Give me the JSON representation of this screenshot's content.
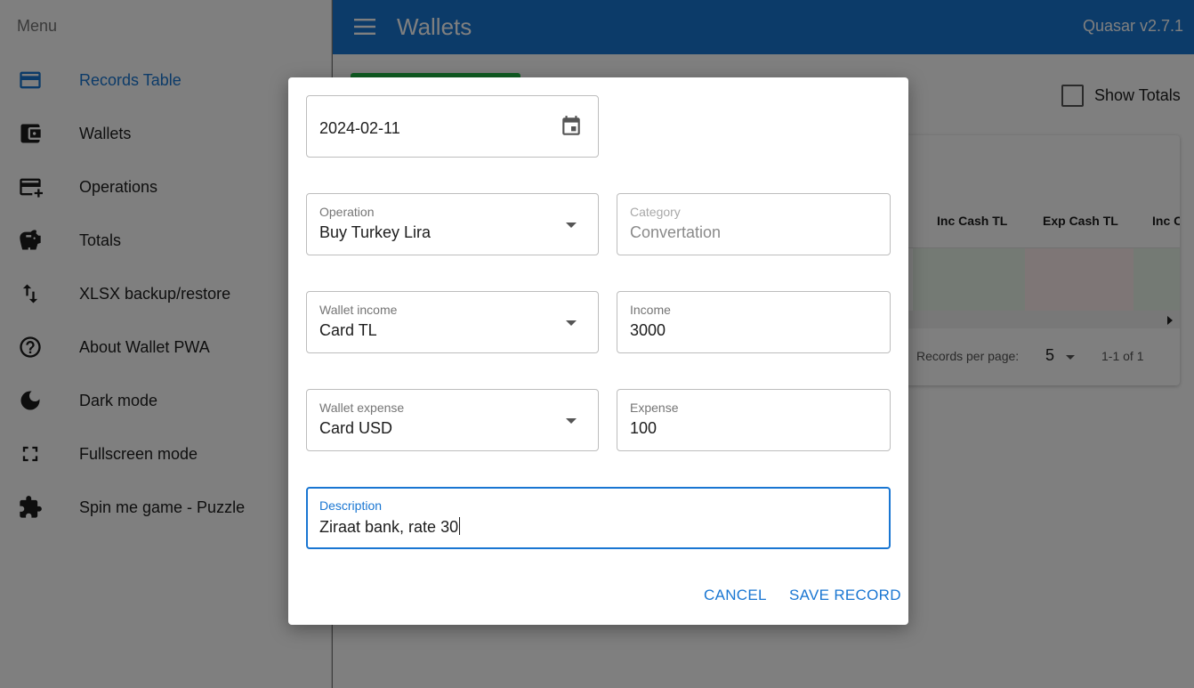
{
  "drawer": {
    "header": "Menu",
    "items": [
      {
        "label": "Records Table",
        "icon": "credit-card-icon",
        "active": true
      },
      {
        "label": "Wallets",
        "icon": "wallet-icon"
      },
      {
        "label": "Operations",
        "icon": "add-card-icon"
      },
      {
        "label": "Totals",
        "icon": "piggy-bank-icon"
      },
      {
        "label": "XLSX backup/restore",
        "icon": "import-export-icon"
      },
      {
        "label": "About Wallet PWA",
        "icon": "help-circle-icon"
      },
      {
        "label": "Dark mode",
        "icon": "moon-icon"
      },
      {
        "label": "Fullscreen mode",
        "icon": "fullscreen-icon"
      },
      {
        "label": "Spin me game - Puzzle",
        "icon": "puzzle-icon"
      }
    ]
  },
  "header": {
    "title": "Wallets",
    "version": "Quasar v2.7.1"
  },
  "page": {
    "show_totals_label": "Show Totals",
    "table": {
      "columns": [
        "Inc Cash TL",
        "Exp Cash TL",
        "Inc C"
      ],
      "records_per_page_label": "Records per page:",
      "records_per_page_value": "5",
      "range_label": "1-1 of 1"
    }
  },
  "dialog": {
    "date": "2024-02-11",
    "operation": {
      "label": "Operation",
      "value": "Buy Turkey Lira"
    },
    "category": {
      "label": "Category",
      "value": "Convertation"
    },
    "wallet_income": {
      "label": "Wallet income",
      "value": "Card TL"
    },
    "income": {
      "label": "Income",
      "value": "3000"
    },
    "wallet_expense": {
      "label": "Wallet expense",
      "value": "Card USD"
    },
    "expense": {
      "label": "Expense",
      "value": "100"
    },
    "description": {
      "label": "Description",
      "value": "Ziraat bank, rate 30"
    },
    "cancel_label": "CANCEL",
    "save_label": "SAVE RECORD"
  },
  "colors": {
    "primary": "#1976d2",
    "positive": "#21ba45",
    "overlay": "rgba(0,0,0,0.5)"
  }
}
